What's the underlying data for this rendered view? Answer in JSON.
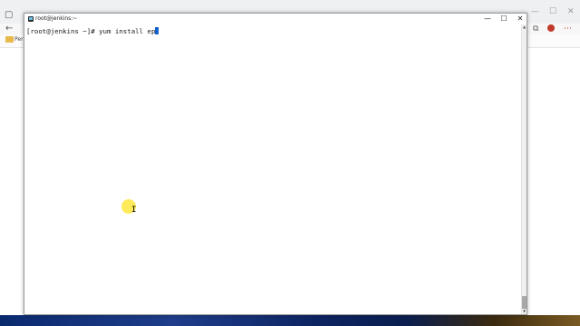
{
  "browser": {
    "bookmark_label": "Perso",
    "back_icon": "arrow-left-icon",
    "tab_icon": "square-icon",
    "folder_icon": "folder-icon",
    "controls": {
      "minimize": "—",
      "maximize": "☐",
      "close": "✕"
    },
    "toolbar_icons": [
      "extensions-icon",
      "avatar-icon",
      "more-icon"
    ]
  },
  "terminal": {
    "title": "root@jenkins:~",
    "prompt": "[root@jenkins ~]# ",
    "command": "yum install ep",
    "controls": {
      "minimize": "—",
      "maximize": "☐",
      "close": "✕"
    },
    "scroll_up": "▲",
    "scroll_down": "▼"
  },
  "pointer": {
    "cursor_glyph": "I",
    "highlight_color": "#ffe63c"
  },
  "colors": {
    "cursor": "#1060d0",
    "taskbar": "#0a2a6e"
  }
}
